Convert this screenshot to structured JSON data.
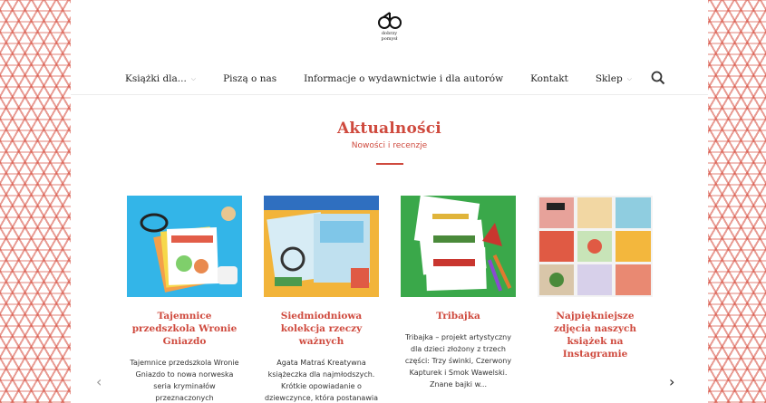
{
  "logo": {
    "line1": "dobrzy",
    "line2": "pomysł"
  },
  "nav": {
    "items": [
      {
        "label": "Książki dla...",
        "has_dropdown": true
      },
      {
        "label": "Piszą o nas",
        "has_dropdown": false
      },
      {
        "label": "Informacje o wydawnictwie i dla autorów",
        "has_dropdown": false
      },
      {
        "label": "Kontakt",
        "has_dropdown": false
      },
      {
        "label": "Sklep",
        "has_dropdown": true
      }
    ],
    "search_icon": "search-icon"
  },
  "section": {
    "title": "Aktualności",
    "subtitle": "Nowości i recenzje"
  },
  "cards": [
    {
      "title": "Tajemnice przedszkola Wronie Gniazdo",
      "excerpt": "Tajemnice przedszkola Wronie Gniazdo to nowa norweska seria kryminałów przeznaczonych"
    },
    {
      "title": "Siedmiodniowa kolekcja rzeczy ważnych",
      "excerpt": "Agata Matraś Kreatywna książeczka dla najmłodszych. Krótkie opowiadanie o dziewczynce, która postanawia"
    },
    {
      "title": "Tribajka",
      "excerpt": "Tribajka – projekt artystyczny dla dzieci złożony z trzech części: Trzy świnki, Czerwony Kapturek i Smok Wawelski. Znane bajki w..."
    },
    {
      "title": "Najpiękniejsze zdjęcia naszych książek na Instagramie",
      "excerpt": ""
    }
  ],
  "carousel": {
    "prev": "‹",
    "next": "›"
  },
  "colors": {
    "accent": "#cf4a3e",
    "pattern": "#d64b3c"
  }
}
